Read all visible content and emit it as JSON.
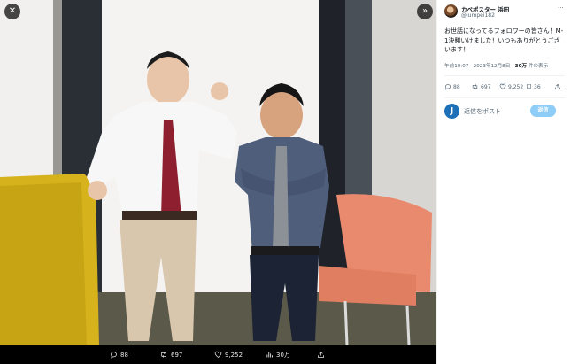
{
  "viewer": {
    "close_icon": "close-icon",
    "expand_icon": "double-chevron-right-icon",
    "actions": {
      "replies": "88",
      "reposts": "697",
      "likes": "9,252",
      "views": "30万"
    }
  },
  "tweet": {
    "display_name": "カベポスター 浜田",
    "handle": "@jumpei182",
    "more_icon": "more-icon",
    "text": "お世話になってるフォロワーの皆さん！M-1決勝いけました！いつもありがとうございます！",
    "timestamp": "午前10:07 · 2023年12月8日 · ",
    "views_count": "30万",
    "views_label": " 件の表示",
    "stats": {
      "replies": "88",
      "reposts": "697",
      "likes": "9,252",
      "bookmarks": "36"
    },
    "reply_avatar_letter": "J",
    "reply_placeholder": "返信をポスト",
    "reply_button": "返信"
  },
  "colors": {
    "accent": "#1d9bf0",
    "reply_button_disabled": "#8ecdf7",
    "muted_text": "#536471"
  }
}
